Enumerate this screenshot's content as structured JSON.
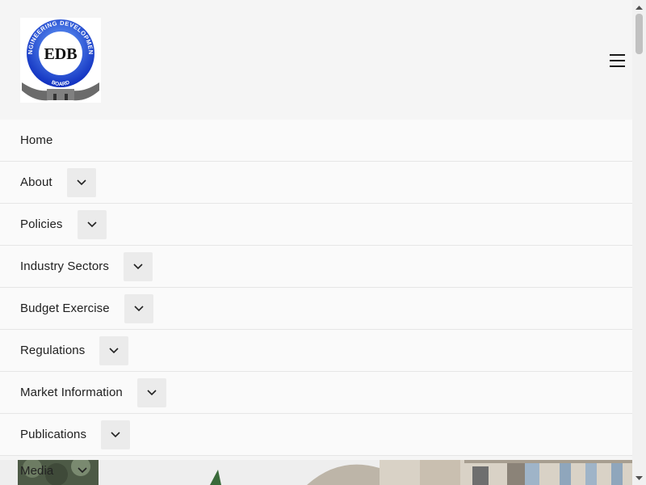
{
  "logo": {
    "abbreviation": "EDB",
    "ring_text": "ENGINEERING DEVELOPMENT",
    "banner_text": "BOARD"
  },
  "header": {
    "menu_icon": "hamburger-icon"
  },
  "nav": {
    "items": [
      {
        "label": "Home",
        "has_submenu": false
      },
      {
        "label": "About",
        "has_submenu": true
      },
      {
        "label": "Policies",
        "has_submenu": true
      },
      {
        "label": "Industry Sectors",
        "has_submenu": true
      },
      {
        "label": "Budget Exercise",
        "has_submenu": true
      },
      {
        "label": "Regulations",
        "has_submenu": true
      },
      {
        "label": "Market Information",
        "has_submenu": true
      },
      {
        "label": "Publications",
        "has_submenu": true
      },
      {
        "label": "Media",
        "has_submenu": true
      }
    ]
  },
  "icons": {
    "submenu_toggle": "chevron-down-icon"
  },
  "colors": {
    "logo_blue": "#1a3fd6",
    "page_bg": "#f5f5f5",
    "button_bg": "#ebebeb"
  }
}
